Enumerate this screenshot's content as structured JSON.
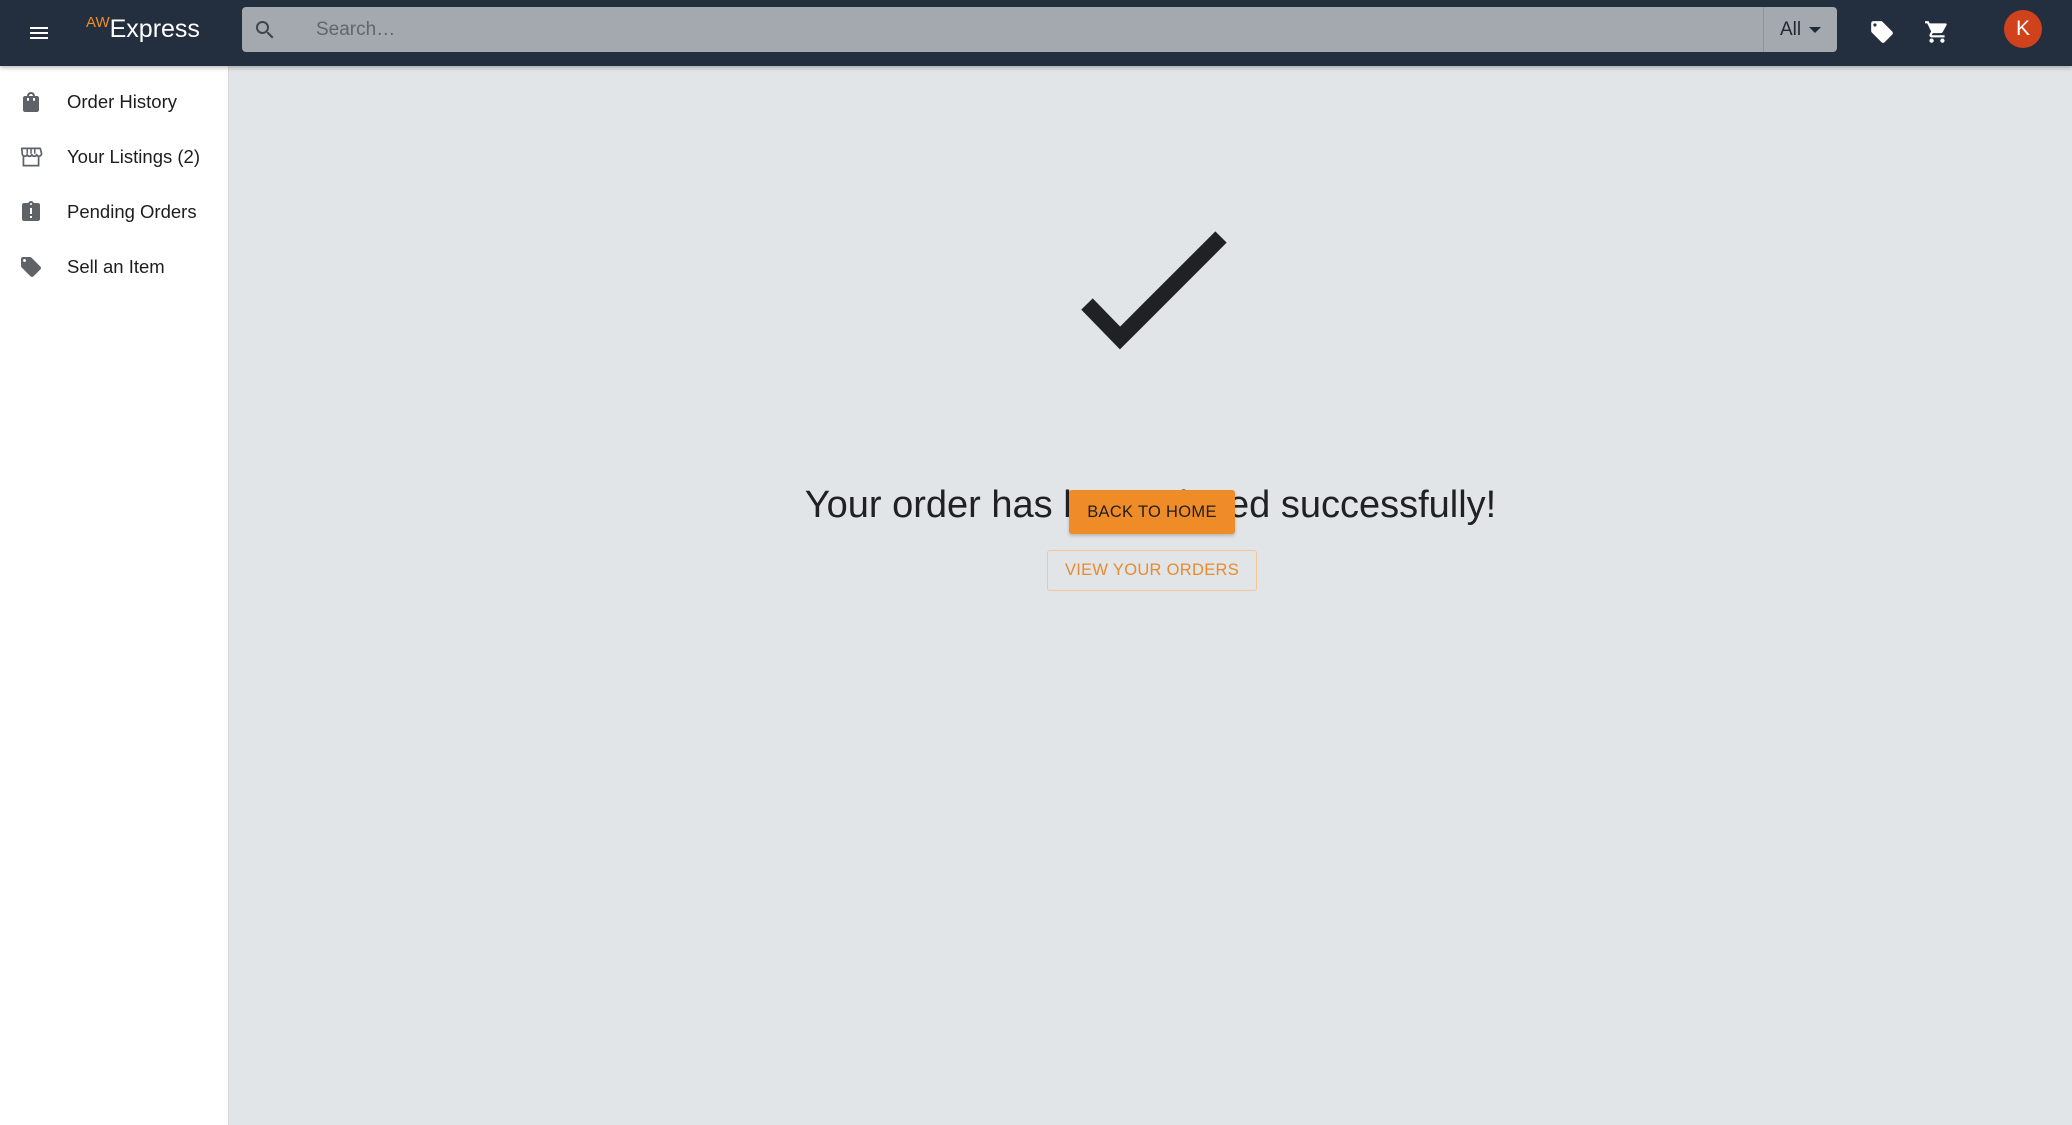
{
  "app": {
    "logo_super": "AW",
    "logo_name": "Express",
    "accent_color": "#f08c27",
    "appbar_color": "#232f3e"
  },
  "search": {
    "placeholder": "Search…",
    "value": "",
    "category": "All"
  },
  "toolbar": {
    "deals_icon": "tag-icon",
    "cart_icon": "shopping-cart-icon",
    "avatar_initial": "K",
    "avatar_color": "#d0421b"
  },
  "sidebar": {
    "items": [
      {
        "label": "Order History",
        "icon": "shopping-bag-icon"
      },
      {
        "label": "Your Listings (2)",
        "icon": "storefront-icon"
      },
      {
        "label": "Pending Orders",
        "icon": "clipboard-alert-icon"
      },
      {
        "label": "Sell an Item",
        "icon": "tag-icon"
      }
    ]
  },
  "main": {
    "status_icon": "checkmark-icon",
    "message": "Your order has been placed successfully!",
    "primary_button": "BACK TO HOME",
    "secondary_button": "VIEW YOUR ORDERS"
  }
}
